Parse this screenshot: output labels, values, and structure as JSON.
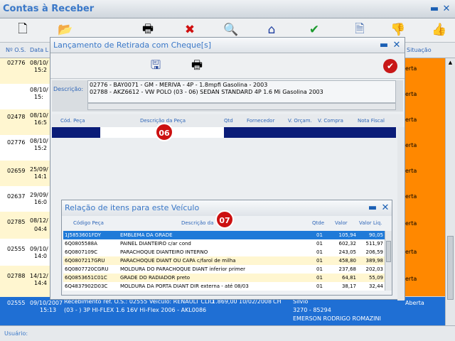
{
  "app": {
    "title": "Contas à Receber"
  },
  "main": {
    "headers": {
      "os": "Nº O.S.",
      "date": "Data L",
      "status": "Situação"
    },
    "rows": [
      {
        "os": "02776",
        "date": "08/10/",
        "time": "15:2",
        "status": "erta"
      },
      {
        "os": "",
        "date": "08/10/",
        "time": "15:",
        "status": "erta"
      },
      {
        "os": "02478",
        "date": "08/10/",
        "time": "16:5",
        "status": "erta"
      },
      {
        "os": "02776",
        "date": "08/10/",
        "time": "15:2",
        "status": "erta"
      },
      {
        "os": "02659",
        "date": "25/09/",
        "time": "14:1",
        "status": "erta"
      },
      {
        "os": "02637",
        "date": "29/09/",
        "time": "16:0",
        "status": "erta"
      },
      {
        "os": "02785",
        "date": "08/12/",
        "time": "04:4",
        "status": "erta"
      },
      {
        "os": "02555",
        "date": "09/10/",
        "time": "14:0",
        "status": "erta"
      },
      {
        "os": "02788",
        "date": "14/12/",
        "time": "14:4",
        "status": "erta"
      }
    ],
    "selected": {
      "os": "02555",
      "date": "09/10/2007",
      "time": "15:13",
      "desc1": "Recebimento ref. O.S.: 02555 Veículo: RENAULT CLIO",
      "desc2": "(03 - ) 3P HI-FLEX 1.6 16V Hi-Flex 2006 - AKL0086",
      "val": "1.869,00",
      "due": "10/02/2008",
      "ch": "CH",
      "person1": "Silvio",
      "person2": "3270 - 85294",
      "person3": "EMERSON RODRIGO ROMAZINI",
      "status": "Aberta"
    }
  },
  "status_bar": {
    "label": "Usuário:"
  },
  "dialog1": {
    "title": "Lançamento de Retirada com Cheque[s]",
    "desc_label": "Descrição:",
    "desc_lines": [
      "02776 - BAY0071 - GM - MERIVA - 4P - 1.8mpfi Gasolina - 2003",
      "02788 - AKZ6612 - VW POLO (03 - 06) SEDAN STANDARD 4P 1.6 Mi Gasolina 2003"
    ],
    "grid_headers": [
      "Cód. Peça",
      "Descrição da Peça",
      "Qtd",
      "Fornecedor",
      "V. Orçam.",
      "V. Compra",
      "Nota Fiscal"
    ],
    "badge": "06"
  },
  "dialog2": {
    "title": "Relação de itens para este Veículo",
    "badge": "07",
    "headers": {
      "code": "Código Peça",
      "desc": "Descrição da",
      "qty": "Qtde",
      "val": "Valor",
      "liq": "Valor Liq."
    },
    "items": [
      {
        "code": "1J5853601FDY",
        "desc": "EMBLEMA DA GRADE",
        "qty": "01",
        "val": "105,94",
        "liq": "90,05"
      },
      {
        "code": "6Q0805588A",
        "desc": "PAINEL DIANTEIRO c/ar cond",
        "qty": "01",
        "val": "602,32",
        "liq": "511,97"
      },
      {
        "code": "6Q0807109C",
        "desc": "PARACHOQUE DIANTEIRO INTERNO",
        "qty": "01",
        "val": "243,05",
        "liq": "206,59"
      },
      {
        "code": "6Q0807217GRU",
        "desc": "PARACHOQUE DIANT OU CAPA c/farol de milha",
        "qty": "01",
        "val": "458,80",
        "liq": "389,98"
      },
      {
        "code": "6Q0807720CGRU",
        "desc": "MOLDURA DO PARACHOQUE DIANT inferior primer",
        "qty": "01",
        "val": "237,68",
        "liq": "202,03"
      },
      {
        "code": "6Q0853651C01C",
        "desc": "GRADE DO RADIADOR preto",
        "qty": "01",
        "val": "64,81",
        "liq": "55,09"
      },
      {
        "code": "6Q4837902D03C",
        "desc": "MOLDURA DA PORTA DIANT DIR externa - até 08/03",
        "qty": "01",
        "val": "38,17",
        "liq": "32,44"
      }
    ]
  }
}
